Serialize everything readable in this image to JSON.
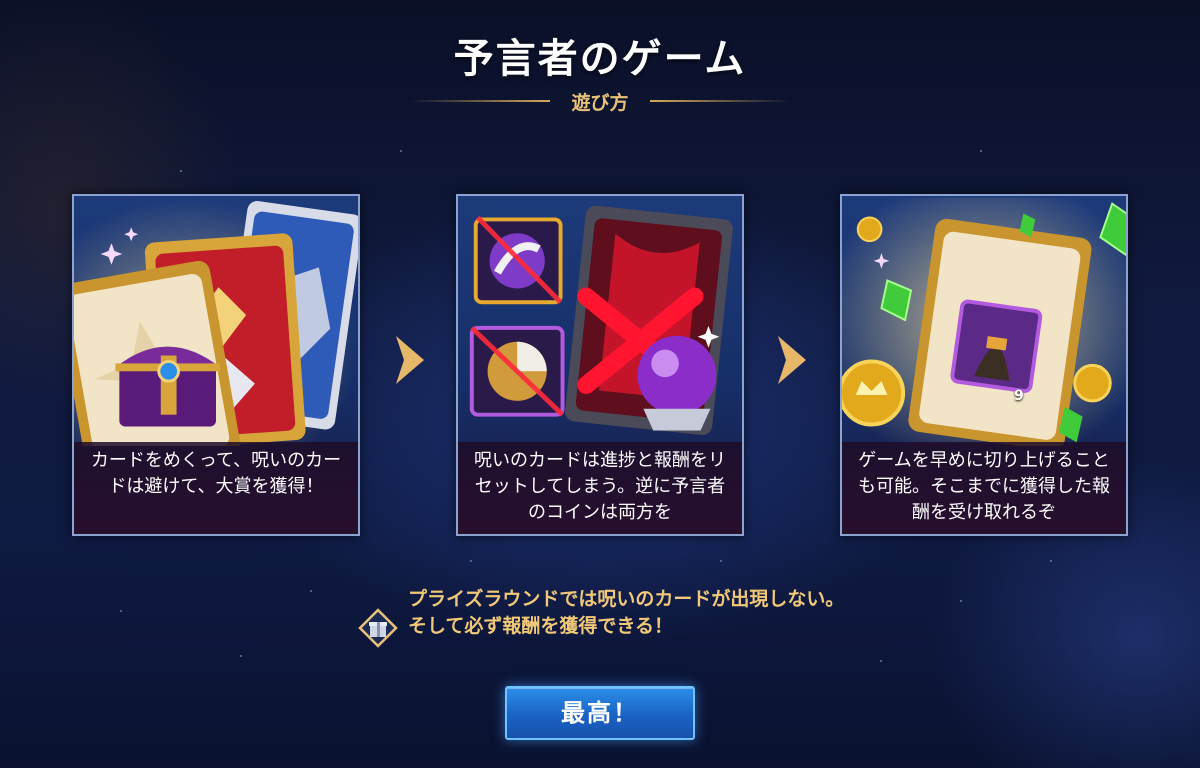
{
  "header": {
    "title": "予言者のゲーム",
    "subtitle": "遊び方"
  },
  "steps": [
    {
      "caption": "カードをめくって、呪いのカードは避けて、大賞を獲得！",
      "art": "card-chest-art"
    },
    {
      "caption": "呪いのカードは進捗と報酬をリセットしてしまう。逆に予言者のコインは両方を",
      "art": "cursed-card-art"
    },
    {
      "caption": "ゲームを早めに切り上げることも可能。そこまでに獲得した報酬を受け取れるぞ",
      "art": "coin-gem-card-art",
      "badge_number": "9"
    }
  ],
  "note": {
    "text": "プライズラウンドでは呪いのカードが出現しない。そして必ず報酬を獲得できる！",
    "icon": "gift-diamond-icon"
  },
  "button": {
    "label": "最高！"
  },
  "colors": {
    "accent_gold": "#e9c27a",
    "button_blue": "#2b8ee8",
    "panel_border": "#8da3cf"
  }
}
